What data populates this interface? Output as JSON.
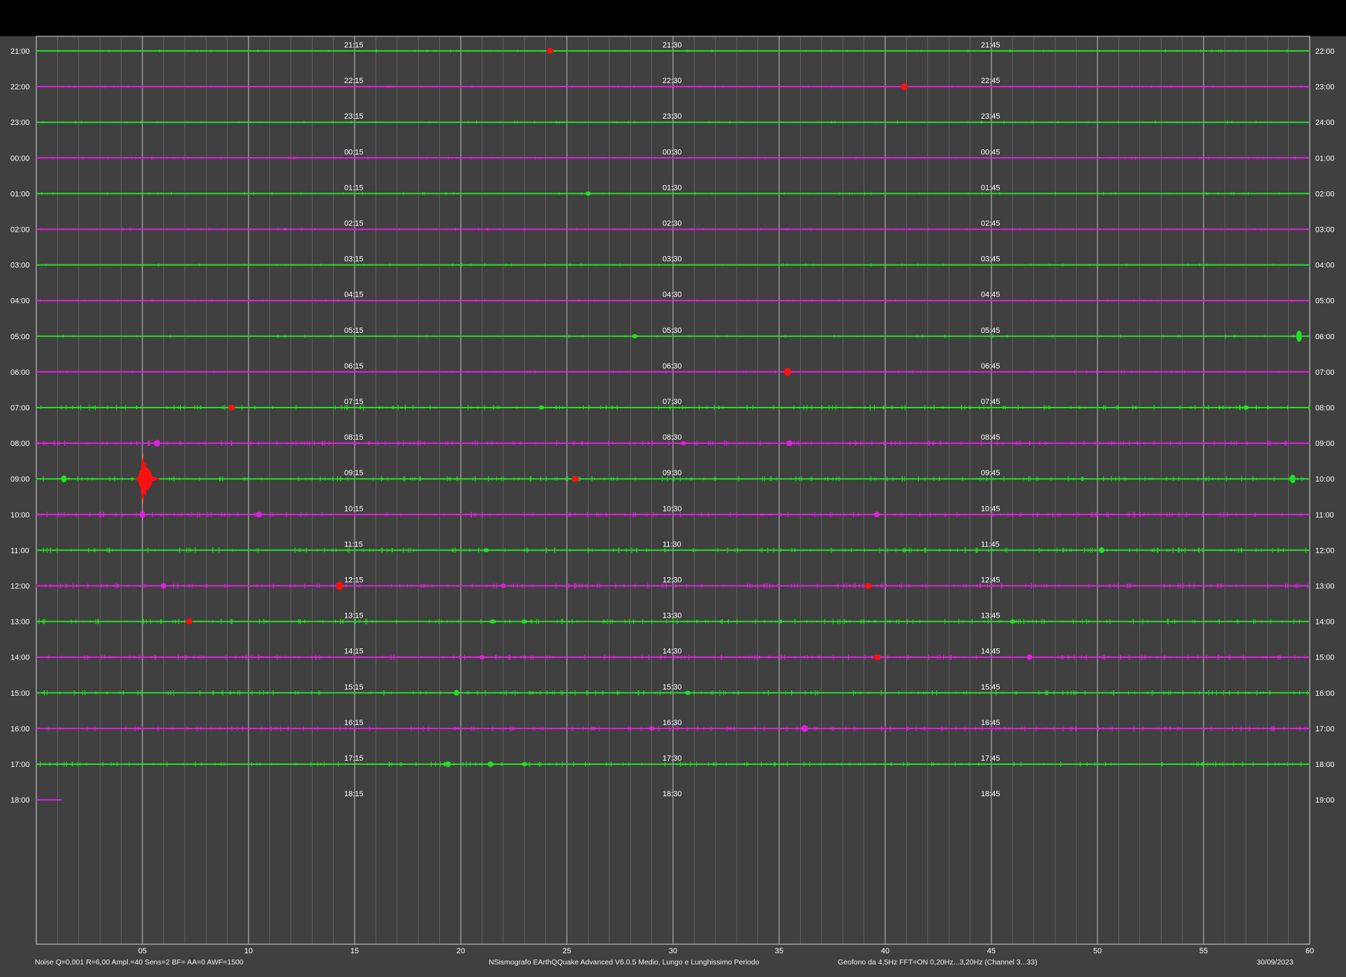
{
  "chart_data": {
    "type": "line",
    "title": "",
    "x_ticks": [
      "05",
      "10",
      "15",
      "20",
      "25",
      "30",
      "35",
      "40",
      "45",
      "50",
      "55",
      "60"
    ],
    "xlim": [
      0,
      60
    ],
    "rows": [
      {
        "left": "21:00",
        "right": "22:00",
        "t1": "21:15",
        "t2": "21:30",
        "t3": "21:45",
        "color": "#22e022",
        "events": [
          {
            "min": 24.2,
            "amp": 4,
            "red": true
          }
        ]
      },
      {
        "left": "22:00",
        "right": "23:00",
        "t1": "22:15",
        "t2": "22:30",
        "t3": "22:45",
        "color": "#e020e0",
        "events": [
          {
            "min": 40.9,
            "amp": 5,
            "red": true
          }
        ]
      },
      {
        "left": "23:00",
        "right": "24:00",
        "t1": "23:15",
        "t2": "23:30",
        "t3": "23:45",
        "color": "#22e022",
        "events": []
      },
      {
        "left": "00:00",
        "right": "01:00",
        "t1": "00:15",
        "t2": "00:30",
        "t3": "00:45",
        "color": "#e020e0",
        "events": []
      },
      {
        "left": "01:00",
        "right": "02:00",
        "t1": "01:15",
        "t2": "01:30",
        "t3": "01:45",
        "color": "#22e022",
        "events": [
          {
            "min": 26.0,
            "amp": 3,
            "red": false
          }
        ]
      },
      {
        "left": "02:00",
        "right": "03:00",
        "t1": "02:15",
        "t2": "02:30",
        "t3": "02:45",
        "color": "#e020e0",
        "events": []
      },
      {
        "left": "03:00",
        "right": "04:00",
        "t1": "03:15",
        "t2": "03:30",
        "t3": "03:45",
        "color": "#22e022",
        "events": []
      },
      {
        "left": "04:00",
        "right": "05:00",
        "t1": "04:15",
        "t2": "04:30",
        "t3": "04:45",
        "color": "#e020e0",
        "events": []
      },
      {
        "left": "05:00",
        "right": "06:00",
        "t1": "05:15",
        "t2": "05:30",
        "t3": "05:45",
        "color": "#22e022",
        "events": [
          {
            "min": 28.2,
            "amp": 3,
            "red": false
          },
          {
            "min": 59.5,
            "amp": 8,
            "red": false
          }
        ]
      },
      {
        "left": "06:00",
        "right": "07:00",
        "t1": "06:15",
        "t2": "06:30",
        "t3": "06:45",
        "color": "#e020e0",
        "events": [
          {
            "min": 35.4,
            "amp": 6,
            "red": true
          }
        ]
      },
      {
        "left": "07:00",
        "right": "08:00",
        "t1": "07:15",
        "t2": "07:30",
        "t3": "07:45",
        "color": "#22e022",
        "events": [
          {
            "min": 9.2,
            "amp": 4,
            "red": true
          },
          {
            "min": 23.8,
            "amp": 3,
            "red": false
          },
          {
            "min": 57.0,
            "amp": 3,
            "red": false
          }
        ]
      },
      {
        "left": "08:00",
        "right": "09:00",
        "t1": "08:15",
        "t2": "08:30",
        "t3": "08:45",
        "color": "#e020e0",
        "events": [
          {
            "min": 5.7,
            "amp": 5,
            "red": false
          },
          {
            "min": 30.5,
            "amp": 3,
            "red": false
          },
          {
            "min": 35.5,
            "amp": 4,
            "red": false
          }
        ]
      },
      {
        "left": "09:00",
        "right": "10:00",
        "t1": "09:15",
        "t2": "09:30",
        "t3": "09:45",
        "color": "#22e022",
        "events": [
          {
            "min": 1.3,
            "amp": 5,
            "red": false
          },
          {
            "min": 5.0,
            "amp": 55,
            "red": true
          },
          {
            "min": 25.4,
            "amp": 4,
            "red": true
          },
          {
            "min": 59.2,
            "amp": 6,
            "red": false
          }
        ]
      },
      {
        "left": "10:00",
        "right": "11:00",
        "t1": "10:15",
        "t2": "10:30",
        "t3": "10:45",
        "color": "#e020e0",
        "events": [
          {
            "min": 5.0,
            "amp": 5,
            "red": false
          },
          {
            "min": 10.5,
            "amp": 4,
            "red": false
          },
          {
            "min": 39.6,
            "amp": 4,
            "red": false
          }
        ]
      },
      {
        "left": "11:00",
        "right": "12:00",
        "t1": "11:15",
        "t2": "11:30",
        "t3": "11:45",
        "color": "#22e022",
        "events": [
          {
            "min": 21.2,
            "amp": 3,
            "red": false
          },
          {
            "min": 50.2,
            "amp": 4,
            "red": false
          }
        ]
      },
      {
        "left": "12:00",
        "right": "13:00",
        "t1": "12:15",
        "t2": "12:30",
        "t3": "12:45",
        "color": "#e020e0",
        "events": [
          {
            "min": 6.0,
            "amp": 4,
            "red": false
          },
          {
            "min": 14.3,
            "amp": 6,
            "red": true
          },
          {
            "min": 22.0,
            "amp": 3,
            "red": false
          },
          {
            "min": 39.2,
            "amp": 4,
            "red": true
          }
        ]
      },
      {
        "left": "13:00",
        "right": "14:00",
        "t1": "13:15",
        "t2": "13:30",
        "t3": "13:45",
        "color": "#22e022",
        "events": [
          {
            "min": 7.2,
            "amp": 4,
            "red": true
          },
          {
            "min": 21.5,
            "amp": 3,
            "red": false
          },
          {
            "min": 23.0,
            "amp": 3,
            "red": false
          },
          {
            "min": 46.0,
            "amp": 3,
            "red": false
          }
        ]
      },
      {
        "left": "14:00",
        "right": "15:00",
        "t1": "14:15",
        "t2": "14:30",
        "t3": "14:45",
        "color": "#e020e0",
        "events": [
          {
            "min": 21.0,
            "amp": 3,
            "red": false
          },
          {
            "min": 39.6,
            "amp": 4,
            "red": true
          },
          {
            "min": 46.8,
            "amp": 4,
            "red": false
          }
        ]
      },
      {
        "left": "15:00",
        "right": "16:00",
        "t1": "15:15",
        "t2": "15:30",
        "t3": "15:45",
        "color": "#22e022",
        "events": [
          {
            "min": 19.8,
            "amp": 4,
            "red": false
          },
          {
            "min": 30.7,
            "amp": 3,
            "red": false
          }
        ]
      },
      {
        "left": "16:00",
        "right": "17:00",
        "t1": "16:15",
        "t2": "16:30",
        "t3": "16:45",
        "color": "#e020e0",
        "events": [
          {
            "min": 29.0,
            "amp": 3,
            "red": false
          },
          {
            "min": 36.2,
            "amp": 5,
            "red": false
          }
        ]
      },
      {
        "left": "17:00",
        "right": "18:00",
        "t1": "17:15",
        "t2": "17:30",
        "t3": "17:45",
        "color": "#22e022",
        "events": [
          {
            "min": 19.4,
            "amp": 4,
            "red": false
          },
          {
            "min": 21.4,
            "amp": 4,
            "red": false
          },
          {
            "min": 23.0,
            "amp": 3,
            "red": false
          }
        ]
      },
      {
        "left": "18:00",
        "right": "19:00",
        "t1": "18:15",
        "t2": "18:30",
        "t3": "18:45",
        "color": "#e020e0",
        "events": [],
        "trace_end_min": 1.2
      }
    ]
  },
  "footer": {
    "left": "Noise Q=0,001 R=6,00 Ampl.=40 Sens=2 BF= AA=0 AWF=1500",
    "center": "NSismografo  EArthQQuake Advanced V6.0.5  Medio, Lungo e Lunghissimo Periodo",
    "right": "Geofono da 4,5Hz FFT=ON 0,20Hz...3,20Hz       (Channel 3...33)",
    "date": "30/09/2023"
  },
  "colors": {
    "background": "#404040",
    "grid_major": "#d8d8d8",
    "grid_minor": "#8a8a8a",
    "trace_even": "#22e022",
    "trace_odd": "#e020e0",
    "event_highlight": "#ff1010"
  }
}
